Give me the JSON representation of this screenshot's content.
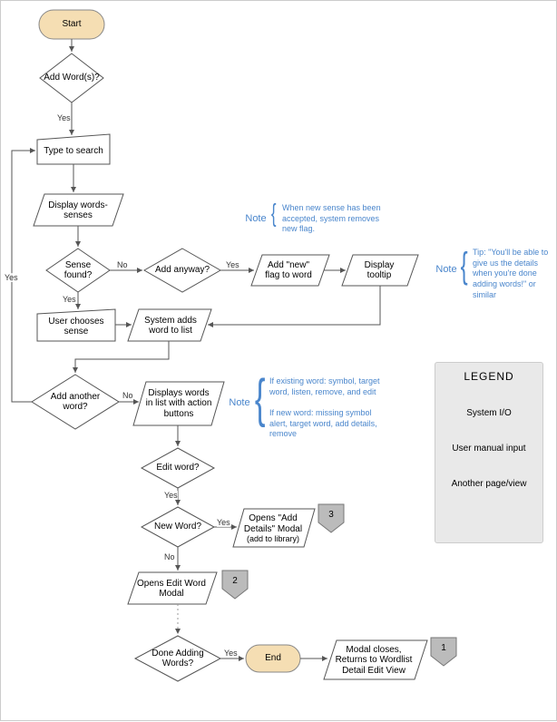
{
  "chart_data": {
    "type": "flowchart",
    "nodes": [
      {
        "id": "start",
        "shape": "terminator",
        "label": "Start"
      },
      {
        "id": "addwords",
        "shape": "decision",
        "label": "Add Word(s)?"
      },
      {
        "id": "typesearch",
        "shape": "manual",
        "label": "Type to search"
      },
      {
        "id": "displayws",
        "shape": "io",
        "label": "Display words-senses"
      },
      {
        "id": "sensefound",
        "shape": "decision",
        "label": "Sense found?"
      },
      {
        "id": "addanyway",
        "shape": "decision",
        "label": "Add anyway?"
      },
      {
        "id": "addnewflag",
        "shape": "io",
        "label": "Add \"new\" flag to word"
      },
      {
        "id": "tooltip",
        "shape": "io",
        "label": "Display tooltip"
      },
      {
        "id": "userchoose",
        "shape": "manual",
        "label": "User chooses sense"
      },
      {
        "id": "systemadds",
        "shape": "io",
        "label": "System adds word to list"
      },
      {
        "id": "addanother",
        "shape": "decision",
        "label": "Add another word?"
      },
      {
        "id": "displaylist",
        "shape": "io",
        "label": "Displays words in list with action buttons"
      },
      {
        "id": "editword",
        "shape": "decision",
        "label": "Edit word?"
      },
      {
        "id": "newword",
        "shape": "decision",
        "label": "New Word?"
      },
      {
        "id": "opensadd",
        "shape": "io",
        "label": "Opens \"Add Details\" Modal",
        "sublabel": "(add to library)"
      },
      {
        "id": "openedit",
        "shape": "io",
        "label": "Opens Edit Word Modal"
      },
      {
        "id": "doneadding",
        "shape": "decision",
        "label": "Done Adding Words?"
      },
      {
        "id": "end",
        "shape": "terminator",
        "label": "End"
      },
      {
        "id": "modalcloses",
        "shape": "io",
        "label": "Modal closes, Returns to Wordlist Detail Edit View"
      },
      {
        "id": "offpage1",
        "shape": "offpage",
        "label": "1"
      },
      {
        "id": "offpage2",
        "shape": "offpage",
        "label": "2"
      },
      {
        "id": "offpage3",
        "shape": "offpage",
        "label": "3"
      }
    ],
    "edges": [
      {
        "from": "start",
        "to": "addwords"
      },
      {
        "from": "addwords",
        "to": "typesearch",
        "label": "Yes"
      },
      {
        "from": "typesearch",
        "to": "displayws"
      },
      {
        "from": "displayws",
        "to": "sensefound"
      },
      {
        "from": "sensefound",
        "to": "userchoose",
        "label": "Yes"
      },
      {
        "from": "sensefound",
        "to": "addanyway",
        "label": "No"
      },
      {
        "from": "addanyway",
        "to": "addnewflag",
        "label": "Yes"
      },
      {
        "from": "addnewflag",
        "to": "tooltip"
      },
      {
        "from": "tooltip",
        "to": "systemadds"
      },
      {
        "from": "userchoose",
        "to": "systemadds"
      },
      {
        "from": "systemadds",
        "to": "addanother"
      },
      {
        "from": "addanother",
        "to": "typesearch",
        "label": "Yes",
        "route": "loop-left"
      },
      {
        "from": "addanother",
        "to": "displaylist",
        "label": "No"
      },
      {
        "from": "displaylist",
        "to": "editword"
      },
      {
        "from": "editword",
        "to": "newword",
        "label": "Yes"
      },
      {
        "from": "newword",
        "to": "opensadd",
        "label": "Yes"
      },
      {
        "from": "newword",
        "to": "openedit",
        "label": "No"
      },
      {
        "from": "openedit",
        "to": "doneadding"
      },
      {
        "from": "doneadding",
        "to": "end",
        "label": "Yes"
      },
      {
        "from": "end",
        "to": "modalcloses"
      },
      {
        "from": "opensadd",
        "to": "offpage3",
        "adjacent": true
      },
      {
        "from": "openedit",
        "to": "offpage2",
        "adjacent": true
      },
      {
        "from": "modalcloses",
        "to": "offpage1",
        "adjacent": true
      }
    ],
    "notes": [
      {
        "label": "Note",
        "near": "addnewflag",
        "text": "When new sense has been accepted, system removes new flag."
      },
      {
        "label": "Note",
        "near": "tooltip",
        "text": "Tip: \"You'll be able to give us the details when you're done adding words!\" or similar"
      },
      {
        "label": "Note",
        "near": "displaylist",
        "text": "If existing word: symbol, target word, listen, remove, and edit\n\nIf new word: missing symbol alert, target word, add details, remove"
      }
    ],
    "legend": {
      "title": "LEGEND",
      "items": [
        {
          "shape": "io",
          "label": "System I/O"
        },
        {
          "shape": "manual",
          "label": "User manual input"
        },
        {
          "shape": "offpage",
          "label": "Another page/view"
        }
      ]
    }
  }
}
